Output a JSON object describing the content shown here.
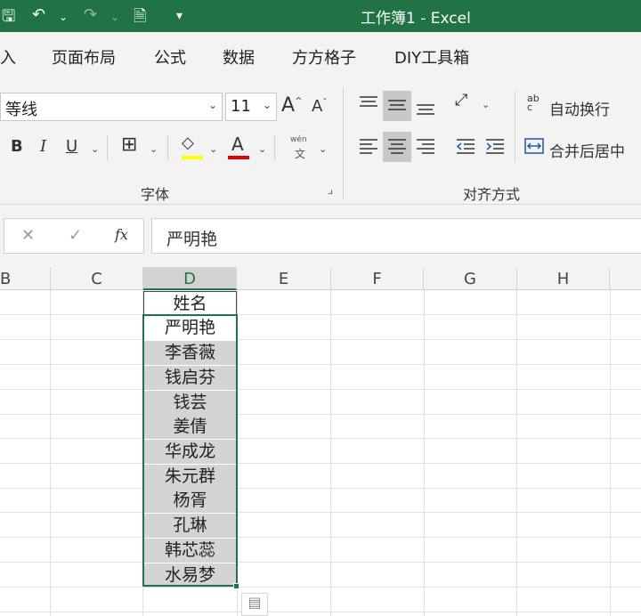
{
  "titlebar": {
    "title": "工作簿1  -  Excel",
    "save_icon_glyph": "🖫",
    "undo_glyph": "↶",
    "redo_glyph": "↷",
    "chevron": "⌄",
    "preview_glyph": "🗎",
    "customize_glyph": "▾"
  },
  "menu": [
    "入",
    "页面布局",
    "公式",
    "数据",
    "方方格子",
    "DIY工具箱"
  ],
  "font_group": {
    "font_name": "等线",
    "font_size": "11",
    "grow_label": "A",
    "shrink_label": "A",
    "bold": "B",
    "italic": "I",
    "underline": "U",
    "font_color_label": "A",
    "phonetic_top": "wén",
    "phonetic_bottom": "文",
    "group_label": "字体",
    "highlight_color": "#ffff00",
    "font_color": "#e00000"
  },
  "align_group": {
    "wrap_text": "自动换行",
    "merge_center": "合并后居中",
    "group_label": "对齐方式",
    "wrap_icon": "ab c",
    "dialog_launcher": "⌟"
  },
  "formula_bar": {
    "cancel": "✕",
    "enter": "✓",
    "fx": "fx",
    "content": "严明艳"
  },
  "columns": [
    "B",
    "C",
    "D",
    "E",
    "F",
    "G",
    "H"
  ],
  "active_column": "D",
  "cells": {
    "header": "姓名",
    "names": [
      "严明艳",
      "李香薇",
      "钱启芬",
      "钱芸",
      "姜倩",
      "华成龙",
      "朱元群",
      "杨胥",
      "孔琳",
      "韩芯蕊",
      "水易梦"
    ]
  },
  "accent_color": "#217346"
}
